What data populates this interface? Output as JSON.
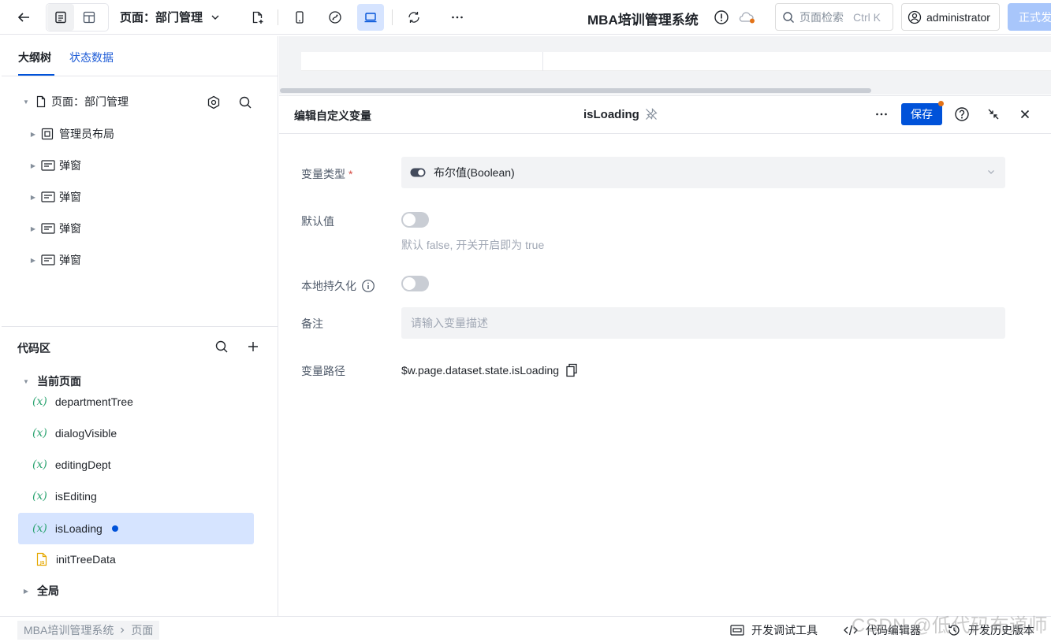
{
  "topbar": {
    "page_selector": "页面：部门管理",
    "app_title": "MBA培训管理系统",
    "search_placeholder": "页面检索",
    "search_shortcut": "Ctrl K",
    "user": "administrator",
    "release_label": "正式发"
  },
  "left": {
    "tabs": [
      "大纲树",
      "状态数据"
    ],
    "tree": {
      "root": "页面：部门管理",
      "children": [
        "管理员布局",
        "弹窗",
        "弹窗",
        "弹窗",
        "弹窗"
      ]
    },
    "code_area_title": "代码区",
    "current_page_label": "当前页面",
    "variables": [
      "departmentTree",
      "dialogVisible",
      "editingDept",
      "isEditing",
      "isLoading"
    ],
    "selected_variable": "isLoading",
    "script_item": "initTreeData",
    "global_label": "全局"
  },
  "editor": {
    "title": "编辑自定义变量",
    "variable_name": "isLoading",
    "save_label": "保存",
    "type_label": "变量类型",
    "required_mark": "*",
    "type_value": "布尔值(Boolean)",
    "default_label": "默认值",
    "default_value": false,
    "default_hint": "默认 false, 开关开启即为 true",
    "persist_label": "本地持久化",
    "persist_value": false,
    "remark_label": "备注",
    "remark_placeholder": "请输入变量描述",
    "path_label": "变量路径",
    "path_value": "$w.page.dataset.state.isLoading"
  },
  "bottombar": {
    "breadcrumb": [
      "MBA培训管理系统",
      "页面"
    ],
    "dev_tools": "开发调试工具",
    "code_editor": "代码编辑器",
    "history": "开发历史版本"
  },
  "watermark": "CSDN @低代码布道师",
  "colors": {
    "accent": "#0052d9",
    "selected_bg": "#d6e4ff",
    "variable_icon": "#2ba471",
    "notify_dot": "#e37318"
  }
}
